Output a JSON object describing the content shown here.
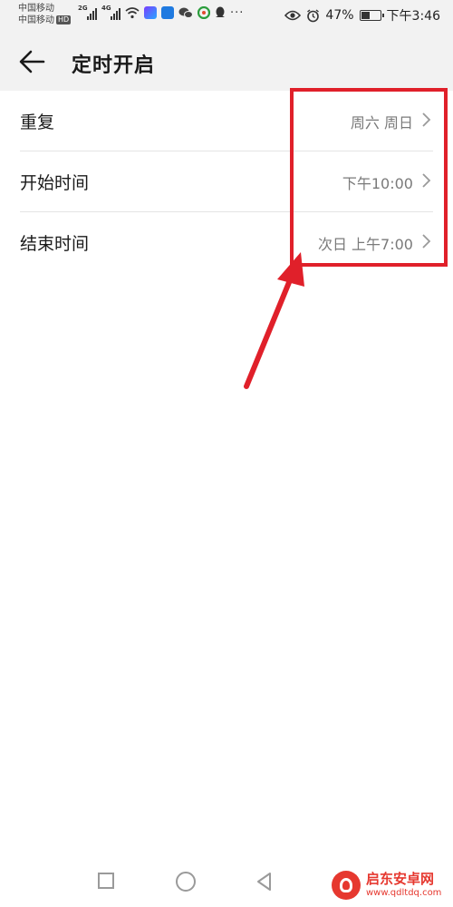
{
  "status_bar": {
    "carrier_1": "中国移动",
    "carrier_2": "中国移动",
    "hd_label": "HD",
    "network_1": "2G",
    "network_2": "4G",
    "battery_percent": "47%",
    "battery_level": 0.47,
    "time": "下午3:46",
    "icons": [
      "signal-icon",
      "wifi-icon",
      "video-app-icon",
      "shield-app-icon",
      "wechat-icon",
      "browser-icon",
      "qq-icon",
      "more-icon",
      "eye-icon",
      "alarm-icon",
      "battery-icon"
    ]
  },
  "header": {
    "title": "定时开启",
    "back_icon": "arrow-left-icon"
  },
  "settings": [
    {
      "label": "重复",
      "value": "周六 周日"
    },
    {
      "label": "开始时间",
      "value": "下午10:00"
    },
    {
      "label": "结束时间",
      "value": "次日 上午7:00"
    }
  ],
  "annotation": {
    "color": "#e0202a"
  },
  "nav_bar": {
    "icons": [
      "recent-apps-icon",
      "home-icon",
      "back-icon"
    ]
  },
  "watermark": {
    "name": "启东安卓网",
    "url": "www.qdltdq.com"
  }
}
